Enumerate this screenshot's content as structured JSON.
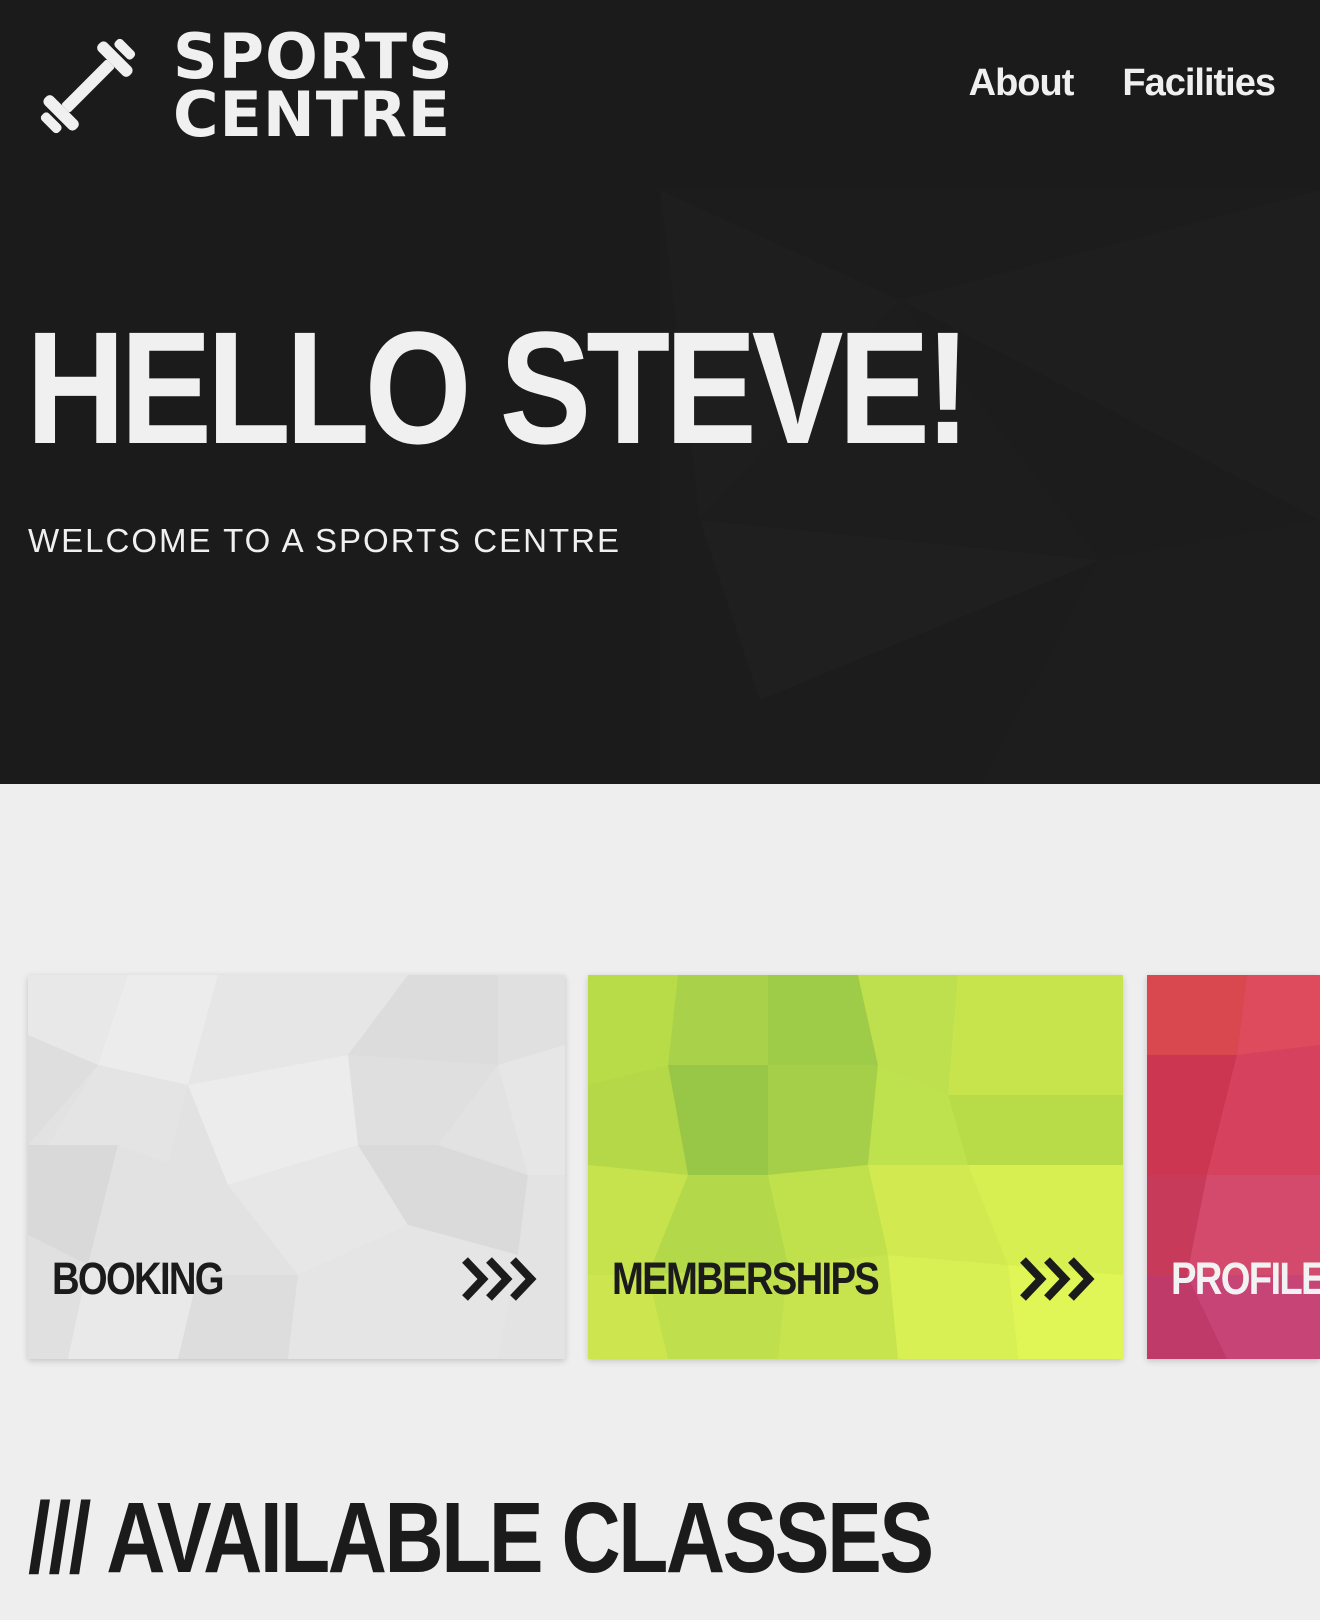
{
  "brand": {
    "line1": "SPORTS",
    "line2": "CENTRE",
    "icon": "dumbbell-icon"
  },
  "nav": {
    "items": [
      {
        "label": "About"
      },
      {
        "label": "Facilities"
      }
    ]
  },
  "hero": {
    "title": "HELLO STEVE!",
    "subtitle": "WELCOME TO A SPORTS CENTRE"
  },
  "cards": [
    {
      "label": "BOOKING",
      "color": "#e3e3e3",
      "icon": "triple-chevron-right-icon"
    },
    {
      "label": "MEMBERSHIPS",
      "color": "#c4e24a",
      "icon": "triple-chevron-right-icon"
    },
    {
      "label": "PROFILE",
      "color": "#d23f5a",
      "icon": "triple-chevron-right-icon"
    }
  ],
  "section": {
    "title": "/// AVAILABLE CLASSES"
  },
  "colors": {
    "dark": "#1b1b1b",
    "light": "#eeeeee",
    "text_light": "#f0f0f0"
  }
}
